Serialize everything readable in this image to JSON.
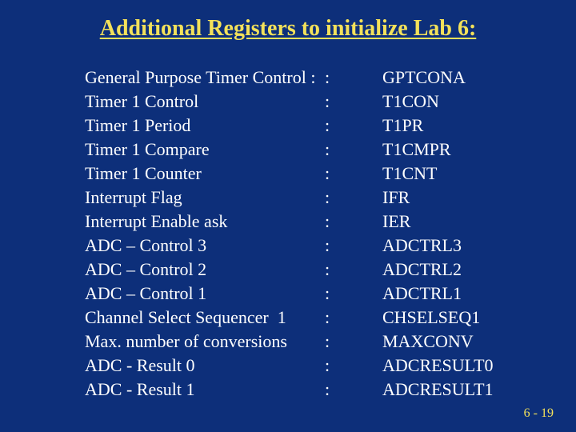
{
  "slide": {
    "title": "Additional Registers to initialize Lab 6:",
    "footer": "6 - 19",
    "rows": [
      {
        "desc": "General Purpose Timer Control :",
        "name": "GPTCONA"
      },
      {
        "desc": "Timer 1 Control",
        "name": "T1CON"
      },
      {
        "desc": "Timer 1 Period",
        "name": "T1PR"
      },
      {
        "desc": "Timer 1 Compare",
        "name": "T1CMPR"
      },
      {
        "desc": "Timer 1 Counter",
        "name": "T1CNT"
      },
      {
        "desc": "Interrupt Flag",
        "name": "IFR"
      },
      {
        "desc": "Interrupt Enable ask",
        "name": "IER"
      },
      {
        "desc": "ADC – Control 3",
        "name": "ADCTRL3"
      },
      {
        "desc": "ADC – Control 2",
        "name": "ADCTRL2"
      },
      {
        "desc": "ADC – Control 1",
        "name": "ADCTRL1"
      },
      {
        "desc": "Channel Select Sequencer  1",
        "name": "CHSELSEQ1"
      },
      {
        "desc": "Max. number of conversions",
        "name": "MAXCONV"
      },
      {
        "desc": "ADC - Result 0",
        "name": "ADCRESULT0"
      },
      {
        "desc": "ADC - Result 1",
        "name": "ADCRESULT1"
      }
    ],
    "colon": ":"
  }
}
